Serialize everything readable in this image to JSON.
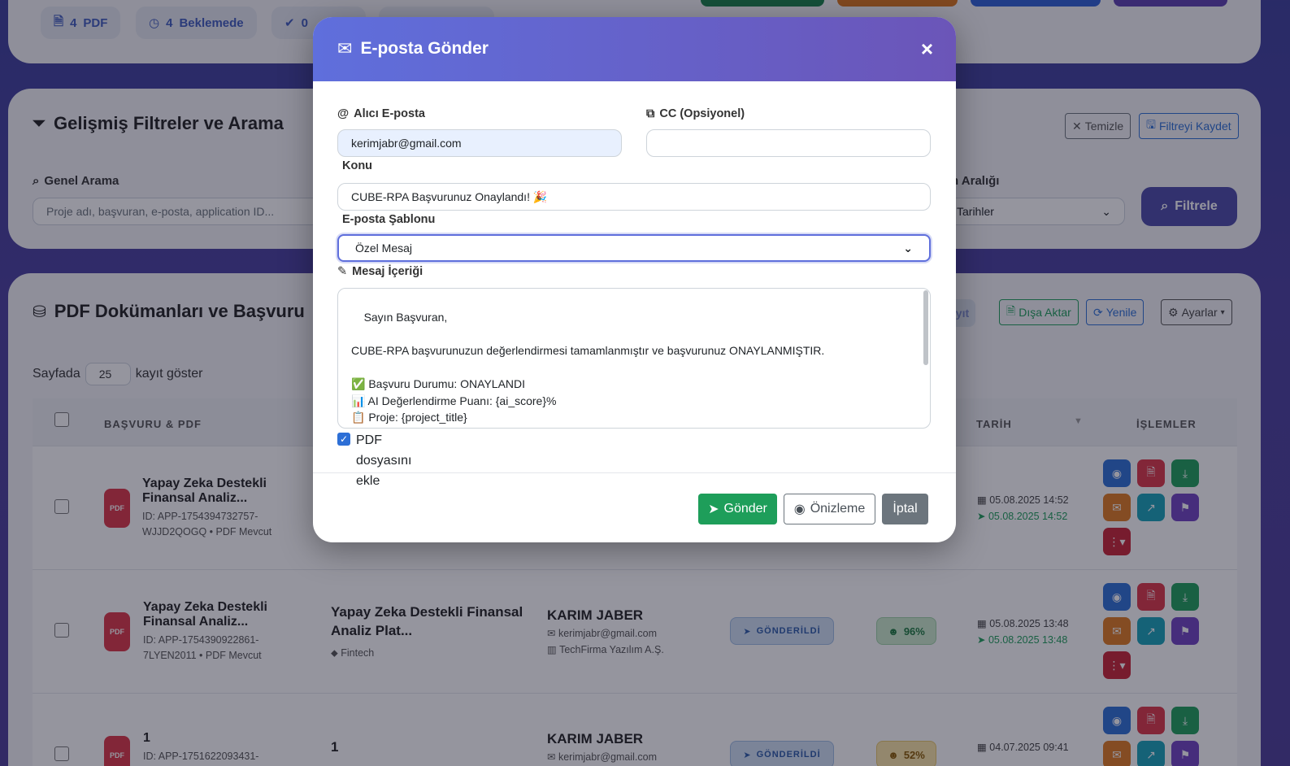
{
  "stats": {
    "pdf": {
      "count": "4",
      "label": "PDF"
    },
    "pending": {
      "count": "4",
      "label": "Beklemede"
    },
    "third": {
      "count": "0"
    }
  },
  "filters": {
    "title": "Gelişmiş Filtreler ve Arama",
    "clear_label": "Temizle",
    "save_label": "Filtreyi Kaydet",
    "search_label": "Genel Arama",
    "search_placeholder": "Proje adı, başvuran, e-posta, application ID...",
    "date_range_label": "n Aralığı",
    "date_select_value": "Tarihler",
    "filter_button": "Filtrele"
  },
  "docs": {
    "title": "PDF Dokümanları ve Başvuru",
    "partial_button": "ayıt",
    "export_label": "Dışa Aktar",
    "refresh_label": "Yenile",
    "settings_label": "Ayarlar",
    "page_size_prefix": "Sayfada",
    "page_size_value": "25",
    "page_size_suffix": "kayıt göster",
    "columns": {
      "application": "BAŞVURU & PDF",
      "date": "TARİH",
      "actions": "İŞLEMLER"
    },
    "rows": [
      {
        "app_title": "Yapay Zeka Destekli Finansal Analiz...",
        "app_meta": "ID: APP-1754394732757-WJJD2QOGQ • PDF Mevcut",
        "date_created": "05.08.2025 14:52",
        "date_sent": "05.08.2025 14:52"
      },
      {
        "app_title": "Yapay Zeka Destekli Finansal Analiz...",
        "app_meta": "ID: APP-1754390922861-7LYEN2011 • PDF Mevcut",
        "project_title": "Yapay Zeka Destekli Finansal Analiz Plat...",
        "project_tag": "Fintech",
        "person": "KARIM JABER",
        "email": "kerimjabr@gmail.com",
        "company": "TechFirma Yazılım A.Ş.",
        "status": "GÖNDERİLDİ",
        "score": "96%",
        "date_created": "05.08.2025 13:48",
        "date_sent": "05.08.2025 13:48"
      },
      {
        "app_title": "1",
        "app_meta": "ID: APP-1751622093431-",
        "project_title": "1",
        "person": "KARIM JABER",
        "email": "kerimjabr@gmail.com",
        "status": "GÖNDERİLDİ",
        "score": "52%",
        "date_created": "04.07.2025 09:41"
      }
    ]
  },
  "modal": {
    "title": "E-posta Gönder",
    "close": "×",
    "to_label": "Alıcı E-posta",
    "to_value": "kerimjabr@gmail.com",
    "cc_label": "CC (Opsiyonel)",
    "cc_value": "",
    "subject_label": "Konu",
    "subject_value": "CUBE-RPA Başvurunuz Onaylandı! 🎉",
    "template_label": "E-posta Şablonu",
    "template_value": "Özel Mesaj",
    "message_label": "Mesaj İçeriği",
    "message_value": "Sayın Başvuran,\n\nCUBE-RPA başvurunuzun değerlendirmesi tamamlanmıştır ve başvurunuz ONAYLANMIŞTIR.\n\n✅ Başvuru Durumu: ONAYLANDI\n📊 AI Değerlendirme Puanı: {ai_score}%\n📋 Proje: {project_title}",
    "attach_checked": true,
    "attach_label_1": "PDF",
    "attach_label_2": "dosyasını",
    "attach_label_3": "ekle",
    "send_label": "Gönder",
    "preview_label": "Önizleme",
    "cancel_label": "İptal"
  },
  "colors": {
    "accent": "#5f6fdc",
    "success": "#1e9e5a",
    "danger": "#dc3545",
    "warning": "#e07b1f",
    "info": "#17a2b8",
    "primary": "#2d6fd6",
    "purple": "#6f42c1"
  }
}
